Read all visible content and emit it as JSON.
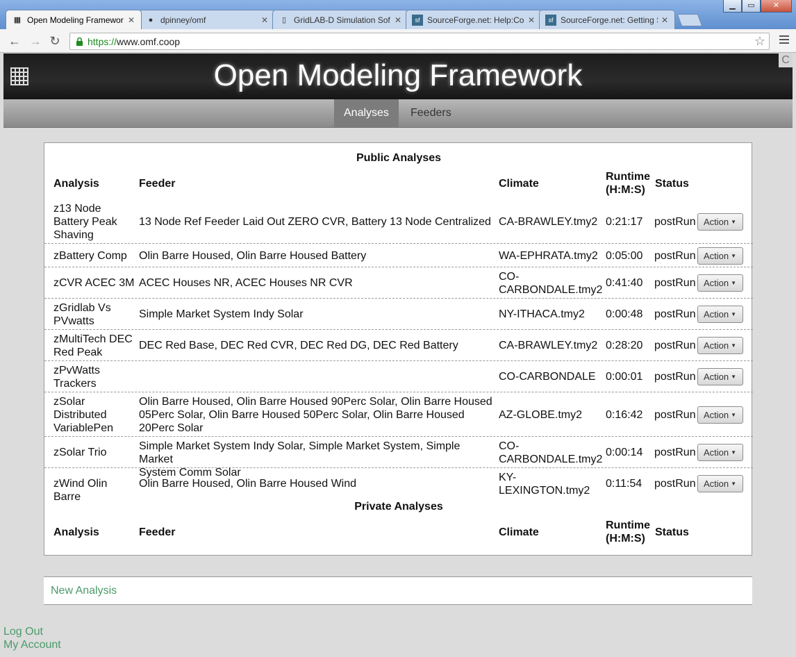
{
  "browser": {
    "tabs": [
      {
        "title": "Open Modeling Framewor",
        "favicon": "grid-icon",
        "active": true
      },
      {
        "title": "dpinney/omf",
        "favicon": "github-icon",
        "active": false
      },
      {
        "title": "GridLAB-D Simulation Sof",
        "favicon": "page-icon",
        "active": false
      },
      {
        "title": "SourceForge.net: Help:Co",
        "favicon": "sourceforge-icon",
        "active": false
      },
      {
        "title": "SourceForge.net: Getting S",
        "favicon": "sourceforge-icon",
        "active": false
      }
    ],
    "url_scheme": "https://",
    "url_host": "www.omf.coop",
    "window_controls": [
      "▁",
      "▭",
      "✕"
    ]
  },
  "site": {
    "title": "Open Modeling Framework",
    "corner": "C",
    "nav": [
      {
        "label": "Analyses",
        "active": true
      },
      {
        "label": "Feeders",
        "active": false
      }
    ]
  },
  "public": {
    "title": "Public Analyses",
    "headers": {
      "analysis": "Analysis",
      "feeder": "Feeder",
      "climate": "Climate",
      "runtime_1": "Runtime",
      "runtime_2": "(H:M:S)",
      "status": "Status"
    },
    "rows": [
      {
        "analysis": [
          "z13 Node",
          "Battery Peak",
          "Shaving"
        ],
        "feeder": [
          "13 Node Ref Feeder Laid Out ZERO CVR, Battery 13 Node Centralized"
        ],
        "climate": [
          "CA-BRAWLEY.tmy2"
        ],
        "runtime": "0:21:17",
        "status": "postRun",
        "action": "Action"
      },
      {
        "analysis": [
          "zBattery Comp"
        ],
        "feeder": [
          "Olin Barre Housed, Olin Barre Housed Battery"
        ],
        "climate": [
          "WA-EPHRATA.tmy2"
        ],
        "runtime": "0:05:00",
        "status": "postRun",
        "action": "Action"
      },
      {
        "analysis": [
          "zCVR ACEC 3M"
        ],
        "feeder": [
          "ACEC Houses NR, ACEC Houses NR CVR"
        ],
        "climate": [
          "CO-",
          "CARBONDALE.tmy2"
        ],
        "runtime": "0:41:40",
        "status": "postRun",
        "action": "Action"
      },
      {
        "analysis": [
          "zGridlab Vs",
          "PVwatts"
        ],
        "feeder": [
          "Simple Market System Indy Solar"
        ],
        "climate": [
          "NY-ITHACA.tmy2"
        ],
        "runtime": "0:00:48",
        "status": "postRun",
        "action": "Action"
      },
      {
        "analysis": [
          "zMultiTech DEC",
          "Red Peak"
        ],
        "feeder": [
          "DEC Red Base, DEC Red CVR, DEC Red DG, DEC Red Battery"
        ],
        "climate": [
          "CA-BRAWLEY.tmy2"
        ],
        "runtime": "0:28:20",
        "status": "postRun",
        "action": "Action"
      },
      {
        "analysis": [
          "zPvWatts",
          "Trackers"
        ],
        "feeder": [],
        "climate": [
          "CO-CARBONDALE"
        ],
        "runtime": "0:00:01",
        "status": "postRun",
        "action": "Action"
      },
      {
        "analysis": [
          "zSolar",
          "Distributed",
          "VariablePen"
        ],
        "feeder": [
          "Olin Barre Housed, Olin Barre Housed 90Perc Solar, Olin Barre Housed",
          "05Perc Solar, Olin Barre Housed 50Perc Solar, Olin Barre Housed",
          "20Perc Solar"
        ],
        "climate": [
          "AZ-GLOBE.tmy2"
        ],
        "runtime": "0:16:42",
        "status": "postRun",
        "action": "Action"
      },
      {
        "analysis": [
          "zSolar Trio"
        ],
        "feeder": [
          "Simple Market System Indy Solar, Simple Market System, Simple Market",
          "System Comm Solar"
        ],
        "climate": [
          "CO-",
          "CARBONDALE.tmy2"
        ],
        "runtime": "0:00:14",
        "status": "postRun",
        "action": "Action"
      },
      {
        "analysis": [
          "zWind Olin Barre"
        ],
        "feeder": [
          "Olin Barre Housed, Olin Barre Housed Wind"
        ],
        "climate": [
          "KY-",
          "LEXINGTON.tmy2"
        ],
        "runtime": "0:11:54",
        "status": "postRun",
        "action": "Action"
      }
    ]
  },
  "private": {
    "title": "Private Analyses",
    "headers": {
      "analysis": "Analysis",
      "feeder": "Feeder",
      "climate": "Climate",
      "runtime_1": "Runtime",
      "runtime_2": "(H:M:S)",
      "status": "Status"
    }
  },
  "new_analysis": "New Analysis",
  "footer": {
    "logout": "Log Out",
    "account": "My Account"
  }
}
